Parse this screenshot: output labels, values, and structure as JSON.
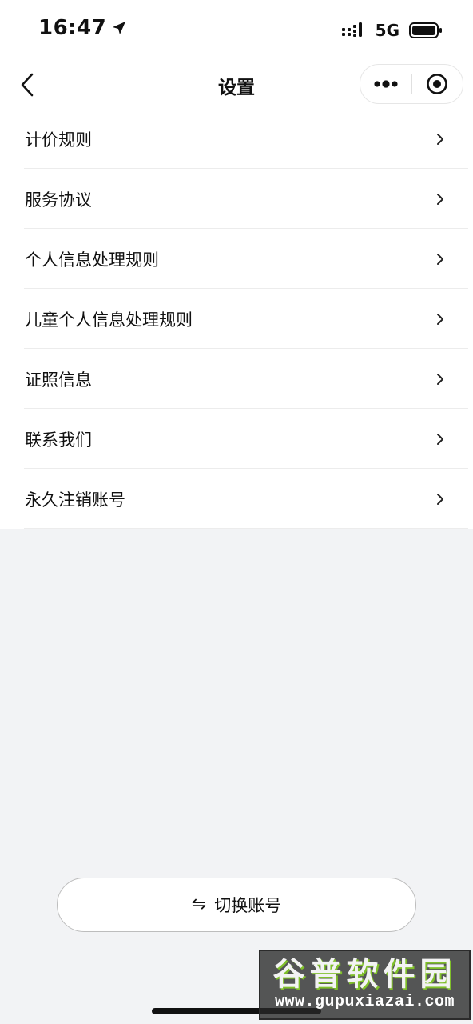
{
  "status_bar": {
    "time": "16:47",
    "network": "5G"
  },
  "nav": {
    "title": "设置"
  },
  "settings": {
    "items": [
      {
        "label": "计价规则"
      },
      {
        "label": "服务协议"
      },
      {
        "label": "个人信息处理规则"
      },
      {
        "label": "儿童个人信息处理规则"
      },
      {
        "label": "证照信息"
      },
      {
        "label": "联系我们"
      },
      {
        "label": "永久注销账号"
      }
    ]
  },
  "switch_account": {
    "icon": "⇋",
    "label": "切换账号"
  },
  "watermark": {
    "title": "谷普软件园",
    "url": "www.gupuxiazai.com"
  },
  "icons": {
    "back": "chevron-left-icon",
    "more": "more-dots-icon",
    "close": "target-circle-icon",
    "chevron": "chevron-right-icon",
    "location": "location-arrow-icon",
    "signal": "signal-icon",
    "battery": "battery-icon"
  },
  "colors": {
    "page_background": "#F2F3F5",
    "card_background": "#FFFFFF",
    "text_primary": "#111111",
    "separator": "#ECECEC"
  }
}
